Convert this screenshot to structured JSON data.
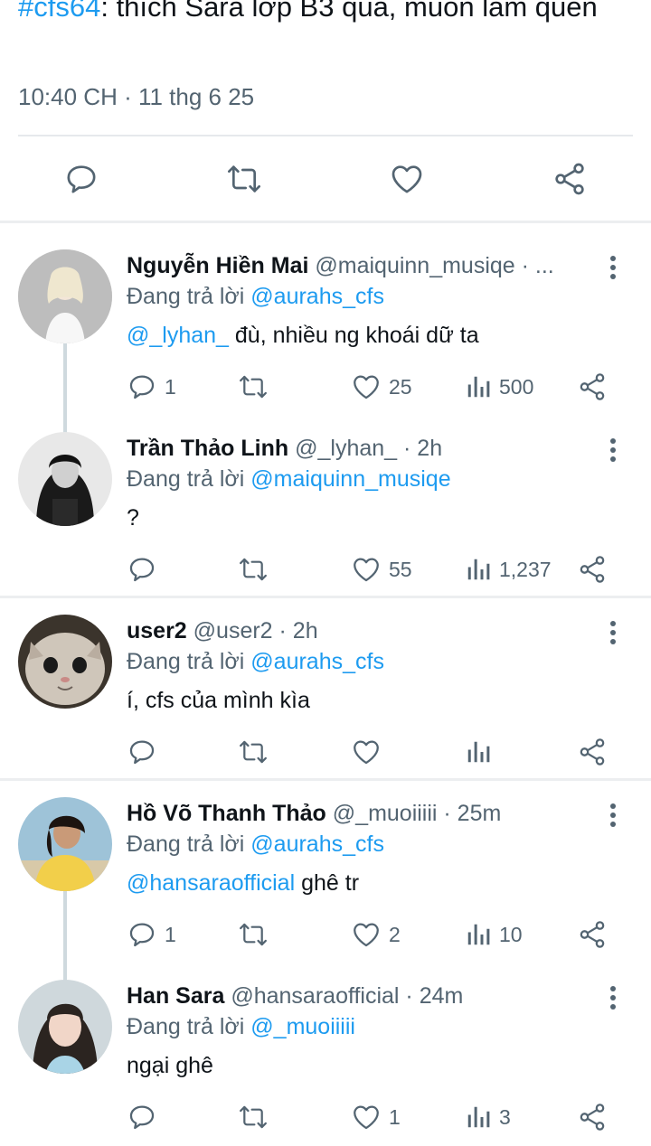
{
  "main_tweet": {
    "hashtag": "#cfs64",
    "text": ": thích Sara lớp B3 quá, muốn làm quen",
    "timestamp": "10:40 CH · 11 thg 6 25"
  },
  "icons": {
    "reply": "reply-icon",
    "retweet": "retweet-icon",
    "like": "heart-icon",
    "views": "views-icon",
    "share": "share-icon",
    "more": "more-vertical-icon"
  },
  "colors": {
    "link": "#1d9bf0",
    "secondary": "#536471",
    "divider": "#e6e9ec",
    "thread": "#cfd9de"
  },
  "replies": [
    {
      "name": "Nguyễn Hiền Mai",
      "handle": "@maiquinn_musiqe · ...",
      "replying_label": "Đang trả lời ",
      "replying_to": "@aurahs_cfs",
      "mention": "@_lyhan_",
      "text": " đù, nhiều ng khoái dữ ta",
      "reply_count": "1",
      "like_count": "25",
      "view_count": "500"
    },
    {
      "name": "Trần Thảo Linh",
      "handle": "@_lyhan_ · 2h",
      "replying_label": "Đang trả lời ",
      "replying_to": "@maiquinn_musiqe",
      "mention": "",
      "text": "?",
      "reply_count": "",
      "like_count": "55",
      "view_count": "1,237"
    },
    {
      "name": "user2",
      "handle": "@user2 · 2h",
      "replying_label": "Đang trả lời ",
      "replying_to": "@aurahs_cfs",
      "mention": "",
      "text": "í, cfs của mình kìa",
      "reply_count": "",
      "like_count": "",
      "view_count": ""
    },
    {
      "name": "Hồ Võ Thanh Thảo",
      "handle": "@_muoiiiii · 25m",
      "replying_label": "Đang trả lời ",
      "replying_to": "@aurahs_cfs",
      "mention": "@hansaraofficial",
      "text": " ghê tr",
      "reply_count": "1",
      "like_count": "2",
      "view_count": "10"
    },
    {
      "name": "Han Sara",
      "handle": "@hansaraofficial · 24m",
      "replying_label": "Đang trả lời ",
      "replying_to": "@_muoiiiii",
      "mention": "",
      "text": "ngại ghê",
      "reply_count": "",
      "like_count": "1",
      "view_count": "3"
    }
  ]
}
